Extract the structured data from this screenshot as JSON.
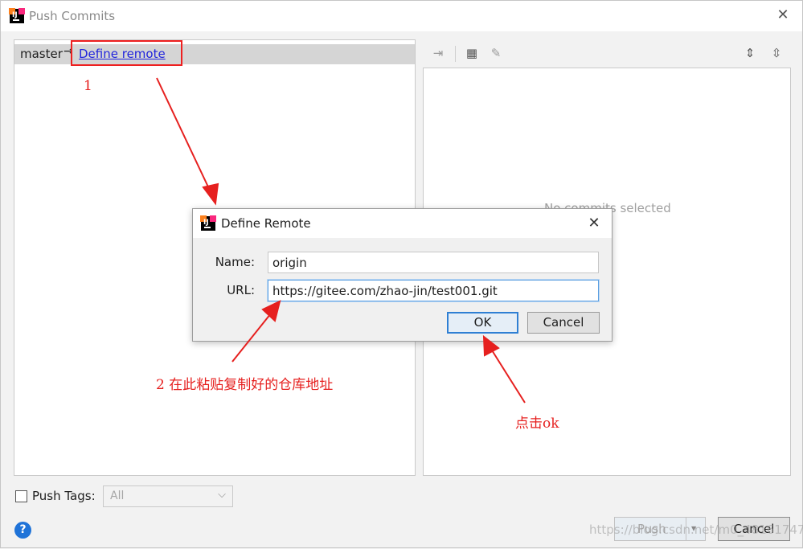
{
  "window": {
    "title": "Push Commits",
    "icon": "intellij-app-icon",
    "icon_text": "IJ"
  },
  "left_panel": {
    "branch": "master",
    "arrow": "→",
    "define_remote_link": "Define remote"
  },
  "right_panel": {
    "toolbar": [
      "merge-icon",
      "group-by-icon",
      "edit-icon",
      "expand-all-icon",
      "collapse-all-icon"
    ],
    "empty_text": "No commits selected"
  },
  "footer": {
    "push_tags_label": "Push Tags:",
    "push_tags_checked": false,
    "tags_select_value": "All",
    "help": "?",
    "push_label": "Push",
    "cancel_label": "Cancel",
    "watermark": "https://blog.csdn.net/m0_48161747"
  },
  "dialog": {
    "title": "Define Remote",
    "icon_text": "IJ",
    "name_label": "Name:",
    "name_value": "origin",
    "url_label": "URL:",
    "url_value": "https://gitee.com/zhao-jin/test001.git",
    "ok_label": "OK",
    "cancel_label": "Cancel"
  },
  "annotations": {
    "step1": "1",
    "step2": "2 在此粘贴复制好的仓库地址",
    "step3": "点击ok",
    "color": "#e6201f"
  }
}
